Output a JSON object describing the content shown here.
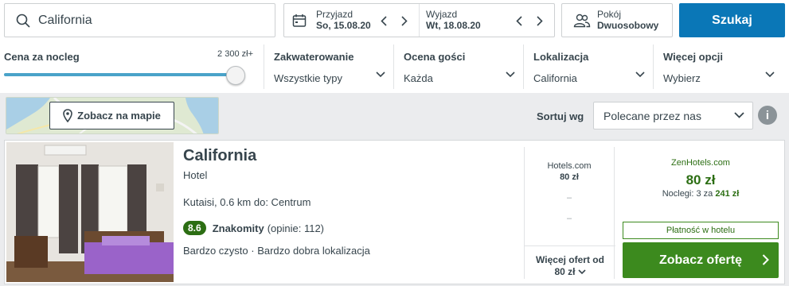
{
  "search": {
    "destination": "California"
  },
  "dates": {
    "checkin": {
      "label": "Przyjazd",
      "value": "So, 15.08.20"
    },
    "checkout": {
      "label": "Wyjazd",
      "value": "Wt, 18.08.20"
    }
  },
  "room": {
    "label": "Pokój",
    "value": "Dwuosobowy"
  },
  "search_button": "Szukaj",
  "filters": {
    "price": {
      "title": "Cena za nocleg",
      "max": "2 300 zł+",
      "level": 1.0
    },
    "accommodation": {
      "title": "Zakwaterowanie",
      "value": "Wszystkie typy"
    },
    "rating": {
      "title": "Ocena gości",
      "value": "Każda"
    },
    "location": {
      "title": "Lokalizacja",
      "value": "California"
    },
    "more": {
      "title": "Więcej opcji",
      "value": "Wybierz"
    }
  },
  "map_button": "Zobacz na mapie",
  "sort": {
    "label": "Sortuj wg",
    "value": "Polecane przez nas",
    "info": "i"
  },
  "result": {
    "name": "California",
    "type": "Hotel",
    "location": "Kutaisi, 0.6 km do: Centrum",
    "rating": {
      "score": "8.6",
      "word": "Znakomity",
      "reviews": "(opinie: 112)"
    },
    "highlights": "Bardzo czysto · Bardzo dobra lokalizacja",
    "other_offer": {
      "site": "Hotels.com",
      "price": "80 zł"
    },
    "dashes": [
      "–",
      "–"
    ],
    "more_offers": {
      "label": "Więcej ofert od",
      "price": "80 zł"
    },
    "deal": {
      "provider": "ZenHotels.com",
      "price": "80 zł",
      "nights_text": "Noclegi: 3 za",
      "nights_total": "241 zł",
      "pay_at_hotel": "Płatność w hotelu",
      "cta": "Zobacz ofertę"
    }
  },
  "colors": {
    "brand_blue": "#0a77b7",
    "deal_green": "#3c8a1e",
    "badge_green": "#2c6e13"
  }
}
